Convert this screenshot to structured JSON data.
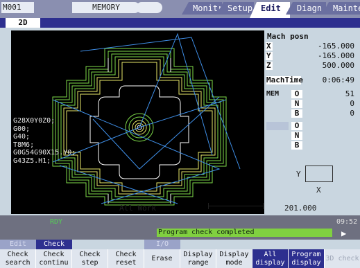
{
  "top": {
    "program": "M001",
    "mode": "MEMORY",
    "tabs": [
      "Monitr",
      "Setup",
      "Edit",
      "Diagn",
      "Mainte"
    ],
    "active_tab": "Edit"
  },
  "subtab": "2D",
  "graphics": {
    "code_lines": [
      "G28X0Y0Z0;",
      "G00;",
      "G40;",
      "T8M6;",
      "G0G54G90X15.Y0;",
      "G43Z5.H1;"
    ],
    "footer_label": "All Work",
    "scale_value": "201.000"
  },
  "position": {
    "title": "Mach posn",
    "axes": [
      {
        "axis": "X",
        "value": "-165.000"
      },
      {
        "axis": "Y",
        "value": "-165.000"
      },
      {
        "axis": "Z",
        "value": "500.000"
      }
    ],
    "mach_time_label": "MachTime",
    "mach_time": "0:06:49",
    "mem_label": "MEM",
    "mem_rows": [
      {
        "label": "O",
        "value": "51"
      },
      {
        "label": "N",
        "value": "0"
      },
      {
        "label": "B",
        "value": "0"
      },
      {
        "label": "O",
        "value": ""
      },
      {
        "label": "N",
        "value": ""
      },
      {
        "label": "B",
        "value": ""
      }
    ],
    "axis_y": "Y",
    "axis_x": "X"
  },
  "status": {
    "rdy": "RDY",
    "time": "09:52",
    "message": "Program check completed",
    "play_icon": "play-icon"
  },
  "fkey_tops": [
    {
      "label": "Edit",
      "style": "dim"
    },
    {
      "label": "Check",
      "style": "active"
    },
    {
      "label": "",
      "style": "none"
    },
    {
      "label": "",
      "style": "none"
    },
    {
      "label": "I/O",
      "style": "dim"
    },
    {
      "label": "",
      "style": "none"
    },
    {
      "label": "",
      "style": "none"
    },
    {
      "label": "",
      "style": "none"
    },
    {
      "label": "",
      "style": "none"
    },
    {
      "label": "",
      "style": "none"
    }
  ],
  "fkeys": [
    {
      "label": "Check search",
      "style": "normal"
    },
    {
      "label": "Check continu",
      "style": "normal"
    },
    {
      "label": "Check step",
      "style": "normal"
    },
    {
      "label": "Check reset",
      "style": "normal"
    },
    {
      "label": "Erase",
      "style": "normal"
    },
    {
      "label": "Display range",
      "style": "normal"
    },
    {
      "label": "Display mode",
      "style": "normal"
    },
    {
      "label": "All display",
      "style": "selected"
    },
    {
      "label": "Program display",
      "style": "selected"
    },
    {
      "label": "3D check",
      "style": "disabled"
    }
  ],
  "colors": {
    "path_green": "#7fdc4a",
    "path_yellow": "#e8e86a",
    "path_white": "#ffffff",
    "path_blue": "#3f8fe8",
    "accent": "#2d2f8f"
  }
}
